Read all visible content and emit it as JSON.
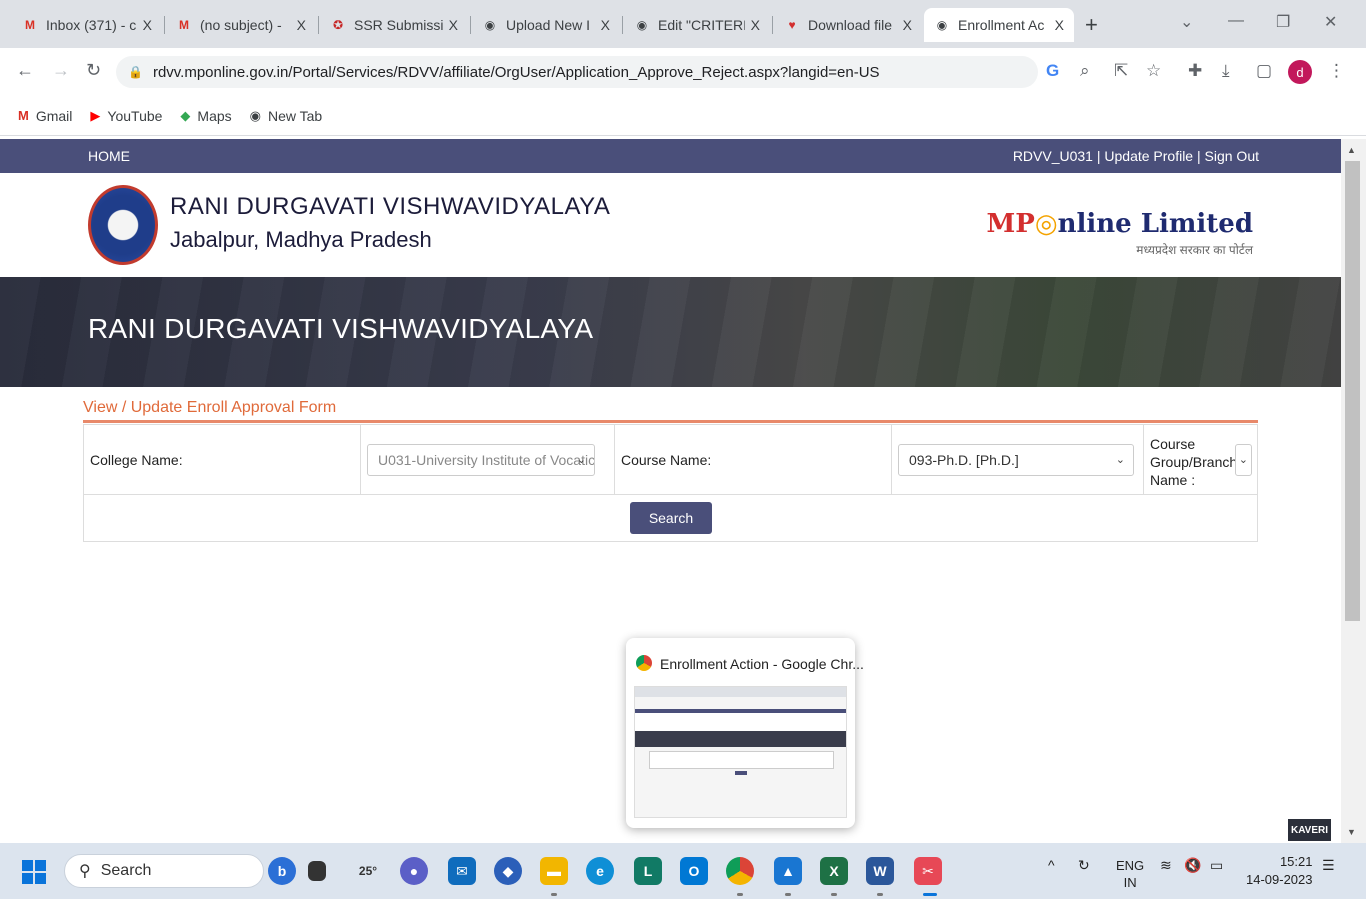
{
  "browser": {
    "tabs": [
      {
        "icon": "gmail-icon",
        "title": "Inbox (371) - c",
        "close": "X"
      },
      {
        "icon": "gmail-icon",
        "title": "(no subject) -",
        "close": "X"
      },
      {
        "icon": "ssr-icon",
        "title": "SSR Submissio",
        "close": "X"
      },
      {
        "icon": "globe-icon",
        "title": "Upload New I",
        "close": "X"
      },
      {
        "icon": "globe-icon",
        "title": "Edit \"CRITERIA",
        "close": "X"
      },
      {
        "icon": "heart-icon",
        "title": "Download file",
        "close": "X"
      },
      {
        "icon": "globe-icon",
        "title": "Enrollment Ac",
        "close": "X"
      }
    ],
    "new_tab": "+",
    "url": "rdvv.mponline.gov.in/Portal/Services/RDVV/affiliate/OrgUser/Application_Approve_Reject.aspx?langid=en-US",
    "avatar_letter": "d",
    "bookmarks": [
      {
        "icon": "gmail-icon",
        "label": "Gmail"
      },
      {
        "icon": "youtube-icon",
        "label": "YouTube"
      },
      {
        "icon": "maps-icon",
        "label": "Maps"
      },
      {
        "icon": "globe-icon",
        "label": "New Tab"
      }
    ]
  },
  "site": {
    "nav_home": "HOME",
    "nav_right": "RDVV_U031 | Update Profile | Sign Out",
    "university_name": "RANI DURGAVATI VISHWAVIDYALAYA",
    "university_place": "Jabalpur, Madhya Pradesh",
    "partner_logo_prefix": "MP",
    "partner_logo_text": "nline Limited",
    "partner_tagline": "मध्यप्रदेश सरकार का पोर्टल",
    "banner_title": "RANI DURGAVATI VISHWAVIDYALAYA"
  },
  "form": {
    "title": "View / Update Enroll Approval Form",
    "college_label": "College Name:",
    "college_value": "U031-University Institute of Vocatic",
    "course_label": "Course Name:",
    "course_value": "093-Ph.D. [Ph.D.]",
    "group_label_1": "Course",
    "group_label_2": "Group/Branch",
    "group_label_3": "Name :",
    "search_button": "Search"
  },
  "popup": {
    "title": "Enrollment Action - Google Chr..."
  },
  "badge": "KAVERI",
  "taskbar": {
    "search_placeholder": "Search",
    "weather": "25°",
    "lang_1": "ENG",
    "lang_2": "IN",
    "time": "15:21",
    "date": "14-09-2023"
  }
}
